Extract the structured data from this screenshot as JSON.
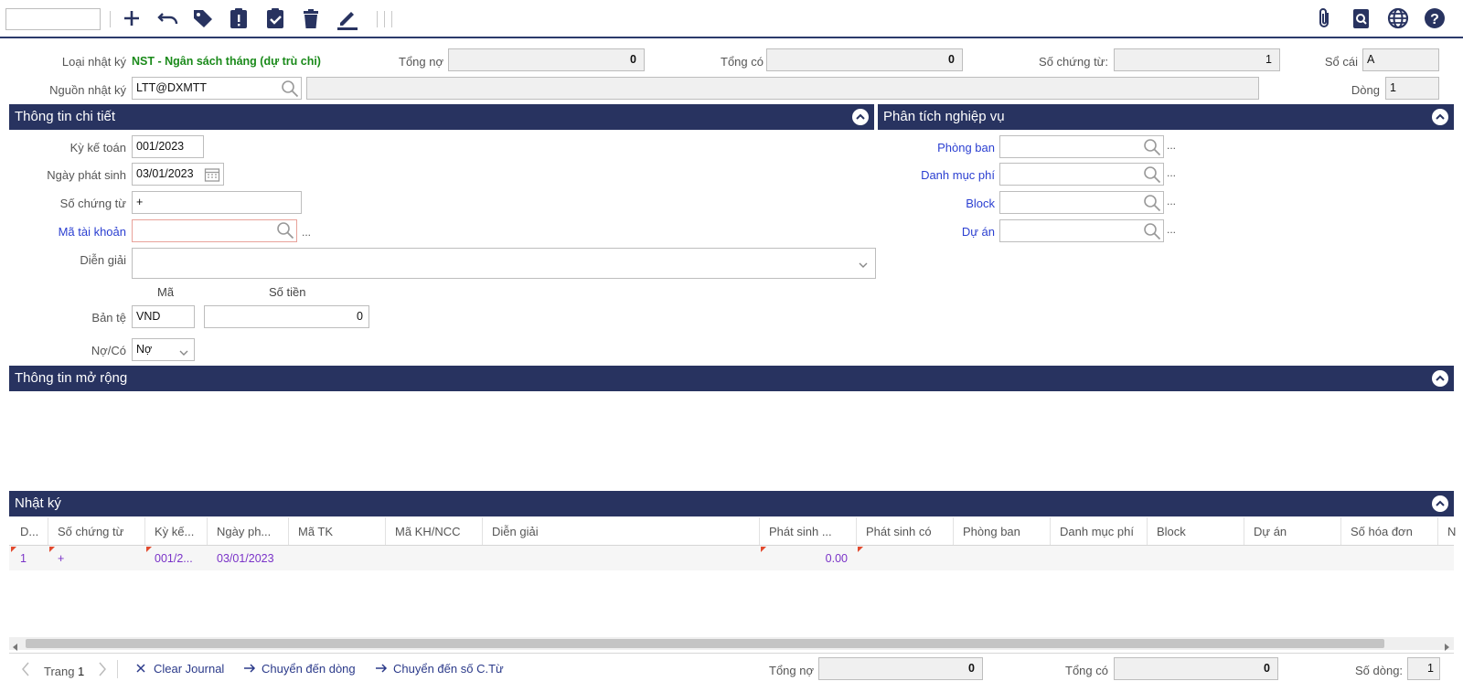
{
  "toolbar": {
    "search_value": "",
    "icons": [
      "add-icon",
      "undo-icon",
      "tag-icon",
      "clipboard-alert-icon",
      "clipboard-check-icon",
      "trash-icon",
      "pen-icon",
      "attachment-icon",
      "search-document-icon",
      "globe-icon",
      "help-icon"
    ]
  },
  "header": {
    "loai_nhat_ky_label": "Loại nhật ký",
    "loai_nhat_ky_value": "NST - Ngân sách tháng (dự trù chi)",
    "tong_no_label": "Tổng nợ",
    "tong_no_value": "0",
    "tong_co_label": "Tổng có",
    "tong_co_value": "0",
    "so_chung_tu_label": "Số chứng từ:",
    "so_chung_tu_value": "1",
    "so_cai_label": "Sổ cái",
    "so_cai_value": "A",
    "nguon_nhat_ky_label": "Nguồn nhật ký",
    "nguon_nhat_ky_value": "LTT@DXMTT",
    "nguon_desc_value": "",
    "dong_label": "Dòng",
    "dong_value": "1"
  },
  "detail": {
    "title": "Thông tin chi tiết",
    "ky_ke_toan_label": "Kỳ kế toán",
    "ky_ke_toan_value": "001/2023",
    "ngay_phat_sinh_label": "Ngày phát sinh",
    "ngay_phat_sinh_value": "03/01/2023",
    "so_chung_tu_label": "Số chứng từ",
    "so_chung_tu_value": "+",
    "ma_tai_khoan_label": "Mã tài khoản",
    "ma_tai_khoan_value": "",
    "dien_giai_label": "Diễn giải",
    "dien_giai_value": "",
    "ma_header": "Mã",
    "so_tien_header": "Số tiền",
    "ban_te_label": "Bản tệ",
    "ban_te_ma": "VND",
    "ban_te_so_tien": "0",
    "no_co_label": "Nợ/Có",
    "no_co_value": "Nợ",
    "ellipsis": "..."
  },
  "analysis": {
    "title": "Phân tích nghiệp vụ",
    "phong_ban_label": "Phòng ban",
    "danh_muc_phi_label": "Danh mục phí",
    "block_label": "Block",
    "du_an_label": "Dự án",
    "ellipsis": "..."
  },
  "extended": {
    "title": "Thông tin mở rộng"
  },
  "journal": {
    "title": "Nhật ký",
    "columns": [
      "D...",
      "Số chứng từ",
      "Kỳ kế...",
      "Ngày ph...",
      "Mã TK",
      "Mã KH/NCC",
      "Diễn giải",
      "Phát sinh ...",
      "Phát sinh có",
      "Phòng ban",
      "Danh mục phí",
      "Block",
      "Dự án",
      "Số hóa đơn",
      "N"
    ],
    "rows": [
      {
        "d": "1",
        "so_chung_tu": "+",
        "ky": "001/2...",
        "ngay": "03/01/2023",
        "phat_sinh_no": "0.00"
      }
    ]
  },
  "footer": {
    "page_label": "Trang",
    "page_number": "1",
    "clear_journal": "Clear Journal",
    "chuyen_den_dong": "Chuyển đến dòng",
    "chuyen_den_so_ct": "Chuyển đến số C.Từ",
    "tong_no_label": "Tổng nợ",
    "tong_no_value": "0",
    "tong_co_label": "Tổng có",
    "tong_co_value": "0",
    "so_dong_label": "Số dòng:",
    "so_dong_value": "1"
  },
  "colors": {
    "bar": "#283360",
    "accent_green": "#1a8a1a",
    "link_blue": "#2b3fd1",
    "grid_purple": "#7a33c8",
    "icon_navy": "#283360"
  }
}
